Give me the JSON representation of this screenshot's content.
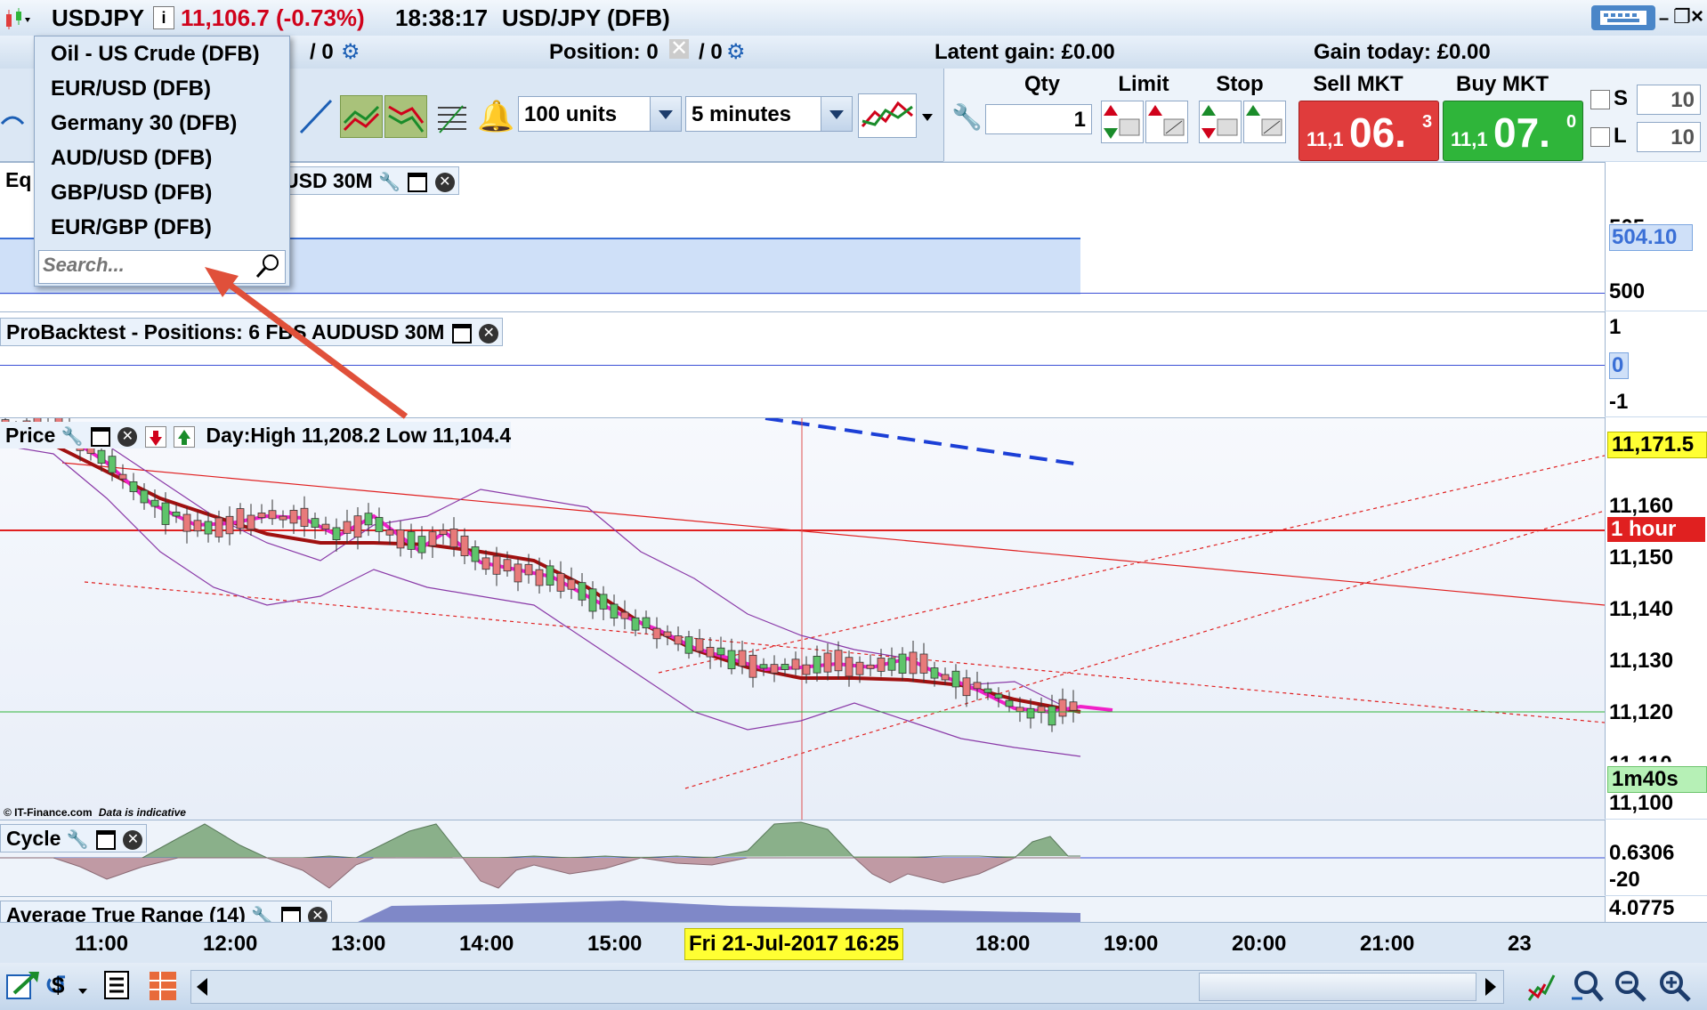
{
  "header": {
    "instrument": "USDJPY",
    "price_change": "11,106.7 (-0.73%)",
    "time": "18:38:17",
    "market": "USD/JPY (DFB)"
  },
  "dropdown": {
    "items": [
      "Oil - US Crude (DFB)",
      "EUR/USD (DFB)",
      "Germany 30 (DFB)",
      "AUD/USD (DFB)",
      "GBP/USD (DFB)",
      "EUR/GBP (DFB)"
    ],
    "search_placeholder": "Search..."
  },
  "stats": {
    "qty_left": "/ 0",
    "position": "Position: 0",
    "pos_right": "/ 0",
    "latent_gain": "Latent gain: £0.00",
    "gain_today": "Gain today: £0.00"
  },
  "toolbar": {
    "units": "100 units",
    "interval": "5 minutes"
  },
  "ticket": {
    "qty_label": "Qty",
    "limit_label": "Limit",
    "stop_label": "Stop",
    "sell_label": "Sell MKT",
    "buy_label": "Buy MKT",
    "qty_value": "1",
    "sell_prefix": "11,1",
    "sell_big": "06.",
    "sell_sup": "3",
    "buy_prefix": "11,1",
    "buy_big": "07.",
    "buy_sup": "0",
    "s_label": "S",
    "l_label": "L",
    "s_value": "10",
    "l_value": "10"
  },
  "panels": {
    "equity_title_left": "Eq",
    "equity_title_right": "USD 30M",
    "probacktest_title": "ProBacktest - Positions: 6 FBS AUDUSD 30M",
    "price_title": "Price",
    "price_daystats": "Day:High 11,208.2 Low 11,104.4",
    "credit": "© IT-Finance.com",
    "credit_note": "Data is indicative",
    "cycle_title": "Cycle",
    "atr_title": "Average True Range (14)"
  },
  "axes": {
    "equity": {
      "top_partial": "505",
      "highlight": "504.10",
      "low": "500"
    },
    "probacktest": {
      "top": "1",
      "mid": "0",
      "bottom": "-1"
    },
    "price": {
      "current": "11,171.5",
      "ticks": [
        "11,160",
        "11,150",
        "11,140",
        "11,130",
        "11,120",
        "11,110",
        "11,100"
      ],
      "hour_label": "1 hour",
      "timer": "1m40s"
    },
    "cycle": {
      "value": "0.6306",
      "low": "-20"
    },
    "atr": {
      "value": "4.0775"
    }
  },
  "time_axis": {
    "labels": [
      "11:00",
      "12:00",
      "13:00",
      "14:00",
      "15:00",
      "18:00",
      "19:00",
      "20:00",
      "21:00",
      "23"
    ],
    "cursor_label": "Fri 21-Jul-2017 16:25"
  },
  "colors": {
    "sell": "#e03c3c",
    "buy": "#2fb53a",
    "panel_bg": "#ffffff",
    "highlight_yellow": "#ffff33"
  }
}
